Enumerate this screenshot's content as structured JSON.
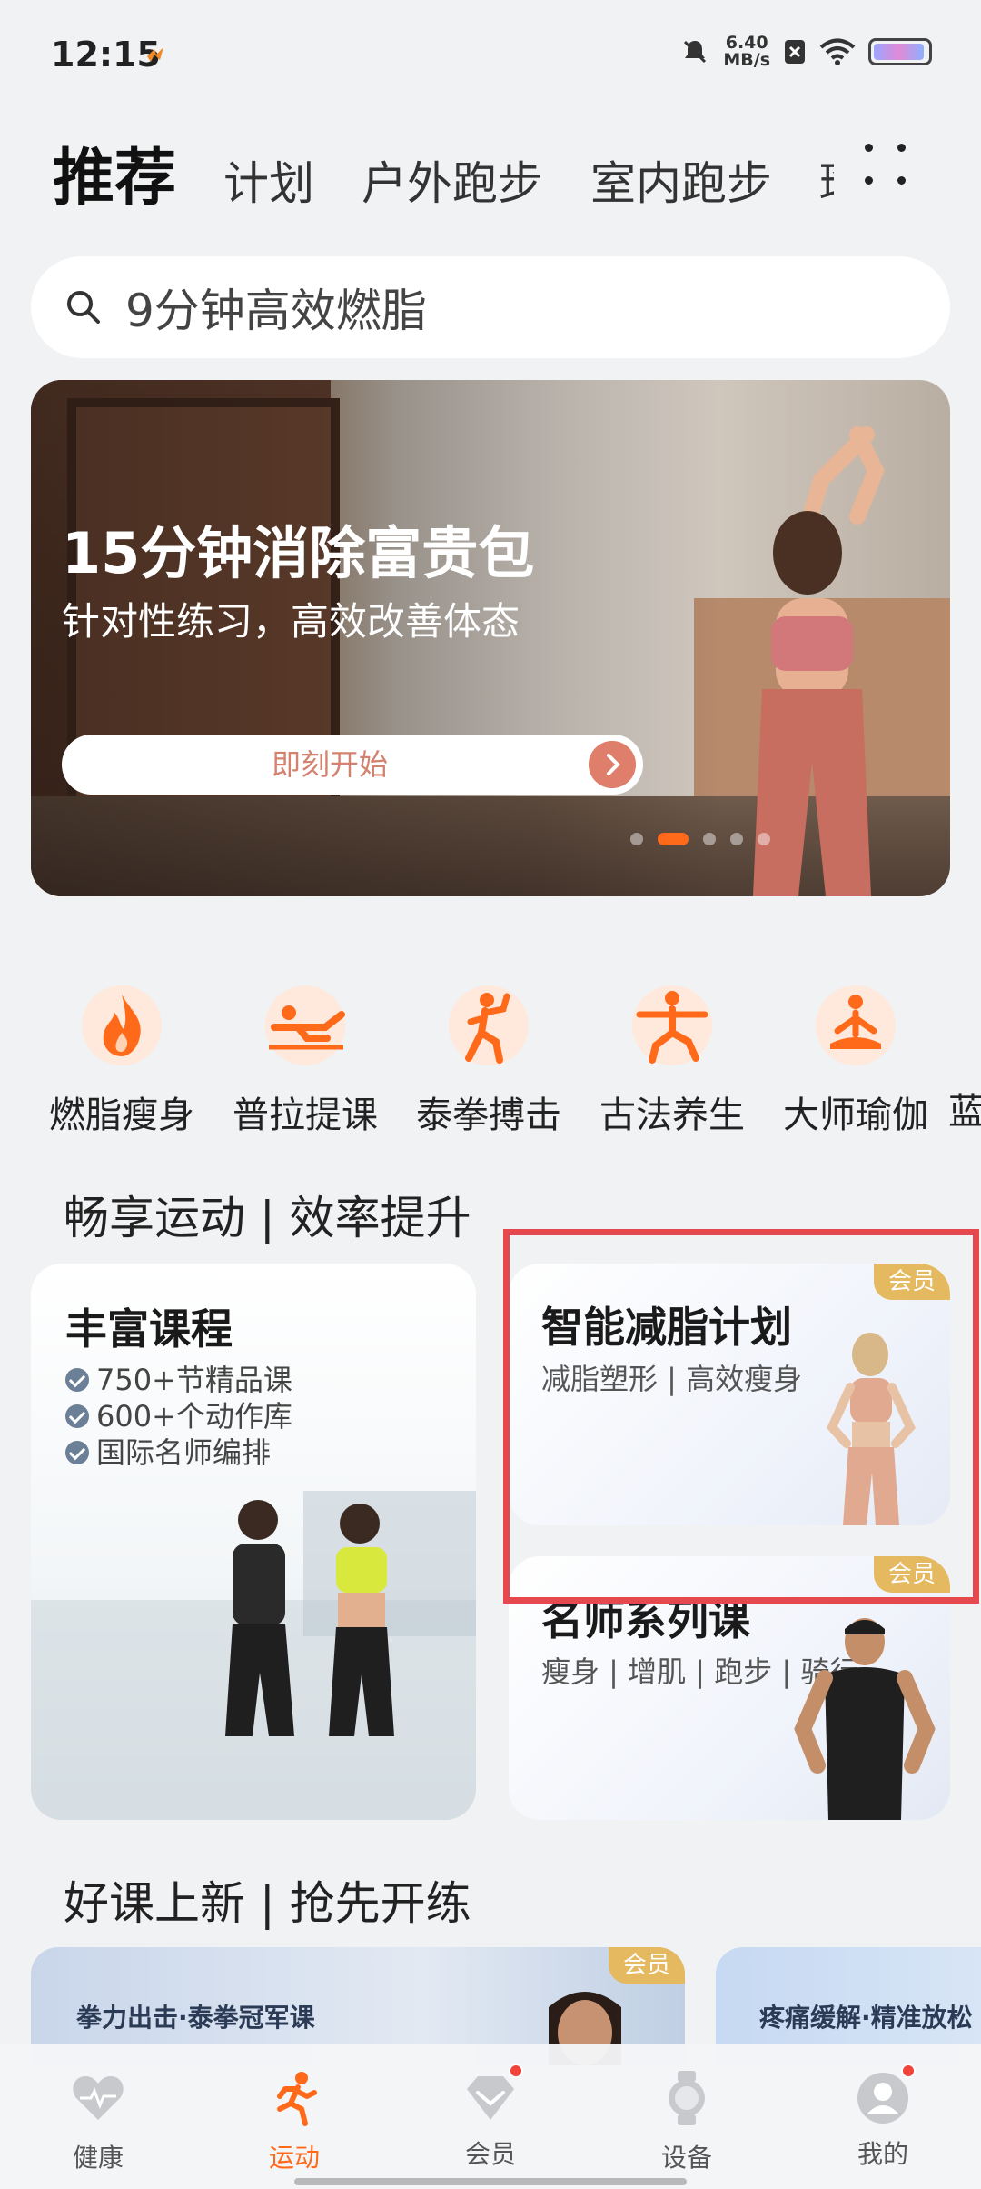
{
  "status_bar": {
    "time": "12:15",
    "speed_value": "6.40",
    "speed_unit": "MB/s"
  },
  "top_tabs": [
    {
      "label": "推荐",
      "active": true
    },
    {
      "label": "计划",
      "active": false
    },
    {
      "label": "户外跑步",
      "active": false
    },
    {
      "label": "室内跑步",
      "active": false
    },
    {
      "label": "瑜",
      "active": false
    }
  ],
  "search": {
    "placeholder": "9分钟高效燃脂"
  },
  "banner": {
    "title": "15分钟消除富贵包",
    "subtitle": "针对性练习，高效改善体态",
    "cta": "即刻开始"
  },
  "categories": [
    {
      "label": "燃脂瘦身",
      "icon": "flame-icon"
    },
    {
      "label": "普拉提课",
      "icon": "pilates-icon"
    },
    {
      "label": "泰拳搏击",
      "icon": "boxing-icon"
    },
    {
      "label": "古法养生",
      "icon": "taichi-icon"
    },
    {
      "label": "大师瑜伽",
      "icon": "yoga-icon"
    },
    {
      "label": "蓝",
      "icon": ""
    }
  ],
  "section1": {
    "title": "畅享运动 | 效率提升"
  },
  "card_courses": {
    "title": "丰富课程",
    "bullets": [
      "750+节精品课",
      "600+个动作库",
      "国际名师编排"
    ]
  },
  "card_plan": {
    "title": "智能减脂计划",
    "subtitle": "减脂塑形 | 高效瘦身",
    "badge": "会员"
  },
  "card_masters": {
    "title": "名师系列课",
    "subtitle": "瘦身 | 增肌 | 跑步 | 骑行",
    "badge": "会员"
  },
  "section2": {
    "title": "好课上新 | 抢先开练"
  },
  "new_courses": [
    {
      "title": "拳力出击·泰拳冠军课",
      "badge": "会员"
    },
    {
      "title": "疼痛缓解·精准放松"
    }
  ],
  "bottom_nav": [
    {
      "label": "健康",
      "icon": "heart-icon",
      "active": false
    },
    {
      "label": "运动",
      "icon": "runner-icon",
      "active": true
    },
    {
      "label": "会员",
      "icon": "vip-diamond-icon",
      "active": false
    },
    {
      "label": "设备",
      "icon": "watch-icon",
      "active": false
    },
    {
      "label": "我的",
      "icon": "profile-icon",
      "active": false
    }
  ],
  "colors": {
    "accent": "#ff6a1a",
    "badge": "#e5b95f",
    "highlight_box": "#e5484d"
  }
}
